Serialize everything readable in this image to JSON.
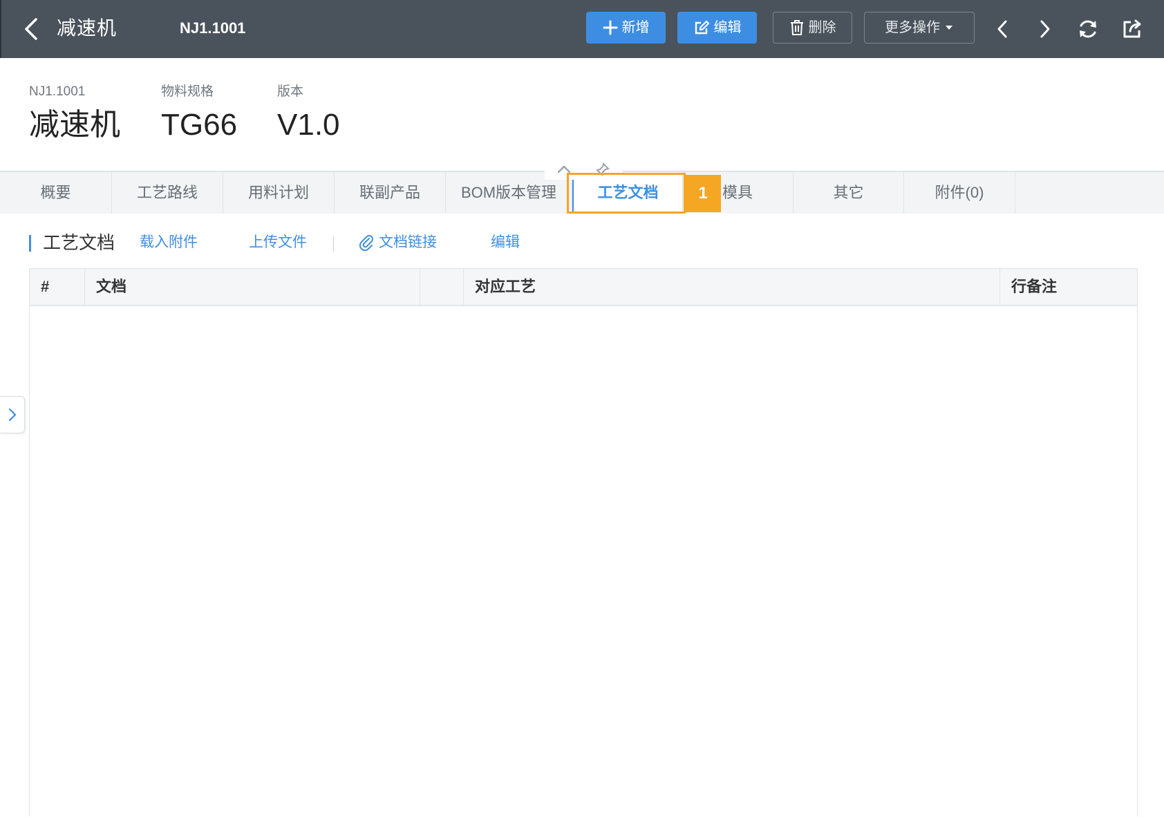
{
  "toolbar": {
    "title": "减速机",
    "code": "NJ1.1001",
    "add_label": "新增",
    "edit_label": "编辑",
    "delete_label": "删除",
    "more_label": "更多操作",
    "accent_color": "#3d8ee3",
    "background_color": "#4a535b"
  },
  "header": {
    "fields": [
      {
        "label": "NJ1.1001",
        "value": "减速机"
      },
      {
        "label": "物料规格",
        "value": "TG66"
      },
      {
        "label": "版本",
        "value": "V1.0"
      }
    ]
  },
  "tabs": [
    {
      "label": "概要"
    },
    {
      "label": "工艺路线"
    },
    {
      "label": "用料计划"
    },
    {
      "label": "联副产品"
    },
    {
      "label": "BOM版本管理"
    },
    {
      "label": "工艺文档",
      "active": true
    },
    {
      "label": "模具"
    },
    {
      "label": "其它"
    },
    {
      "label": "附件(0)"
    }
  ],
  "annotation": {
    "step": "1",
    "color": "#f5a623"
  },
  "section": {
    "title": "工艺文档",
    "actions": {
      "load_attachment": "载入附件",
      "upload_file": "上传文件",
      "doc_link": "文档链接",
      "edit": "编辑"
    }
  },
  "table": {
    "columns": [
      "#",
      "文档",
      "",
      "对应工艺",
      "行备注"
    ],
    "rows": []
  },
  "icons": {
    "back": "chevron-left-icon",
    "add": "plus-icon",
    "edit": "edit-icon",
    "delete": "trash-icon",
    "more": "caret-down-icon",
    "prev": "chevron-left-icon",
    "next": "chevron-right-icon",
    "refresh": "refresh-icon",
    "share": "share-icon",
    "link": "paperclip-icon",
    "expand": "chevron-right-icon"
  }
}
